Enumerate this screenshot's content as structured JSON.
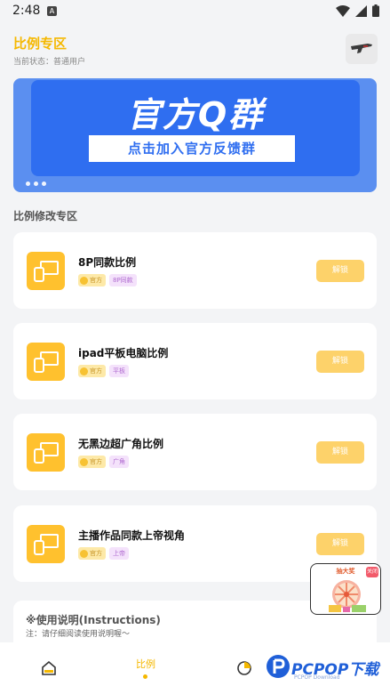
{
  "status_bar": {
    "time": "2:48",
    "notif_icon": "A"
  },
  "header": {
    "title": "比例专区",
    "subtitle": "当前状态：普通用户"
  },
  "banner": {
    "title": "官方Q群",
    "subtitle": "点击加入官方反馈群"
  },
  "section": {
    "title": "比例修改专区"
  },
  "cards": [
    {
      "name": "8P同款比例",
      "tag_official": "官方",
      "tag_kind": "8P同款",
      "button": "解锁"
    },
    {
      "name": "ipad平板电脑比例",
      "tag_official": "官方",
      "tag_kind": "平板",
      "button": "解锁"
    },
    {
      "name": "无黑边超广角比例",
      "tag_official": "官方",
      "tag_kind": "广角",
      "button": "解锁"
    },
    {
      "name": "主播作品同款上帝视角",
      "tag_official": "官方",
      "tag_kind": "上帝",
      "button": "解锁"
    }
  ],
  "instructions": {
    "title": "※使用说明(Instructions)",
    "note": "注：请仔细阅读使用说明喔～"
  },
  "float_ad": {
    "title": "抽大奖",
    "close": "关闭"
  },
  "bottom_nav": {
    "active_label": "比例"
  },
  "watermark": {
    "brand": "PCPOP下载",
    "small": "PCPOP Download"
  },
  "colors": {
    "accent": "#f5b800",
    "banner_blue": "#2f6ef0",
    "card_icon": "#ffc12e"
  }
}
